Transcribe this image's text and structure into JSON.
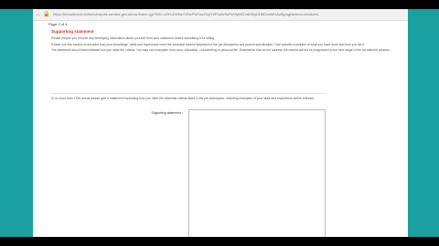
{
  "browser": {
    "url": "https://recruitment.civilservicejobs.service.gov.uk/csr/index.cgi?SID=cGFnZWNsYXNzPUFwcGxpY2F0aW9uRm9ybSZvd25lcj01MDcwMDAw&pageaction=viewform"
  },
  "page": {
    "page_label": "Page 2 of 4",
    "section_heading": "Supporting statement",
    "paragraphs": [
      "Please ensure you remove any identifying information about yourself from your statement before submitting it for sifting.",
      "Please use this section to describe how your knowledge, skills and experience meet the essential criteria described in the job description and person specification. Give specific examples of what you have done and how you did it.",
      "The statement should demonstrate how you meet the criteria. You may use examples from work, education, volunteering or personal life. Statements that do not address the criteria will not be progressed to the next stage of the recruitment process."
    ],
    "instruction": "In no more than 1250 words please give a statement explaining how you meet the essential criteria listed in the job description, including examples of your skills and experience where relevant.",
    "field_label": "Supporting statement",
    "required_marker": "*",
    "textarea_value": ""
  }
}
